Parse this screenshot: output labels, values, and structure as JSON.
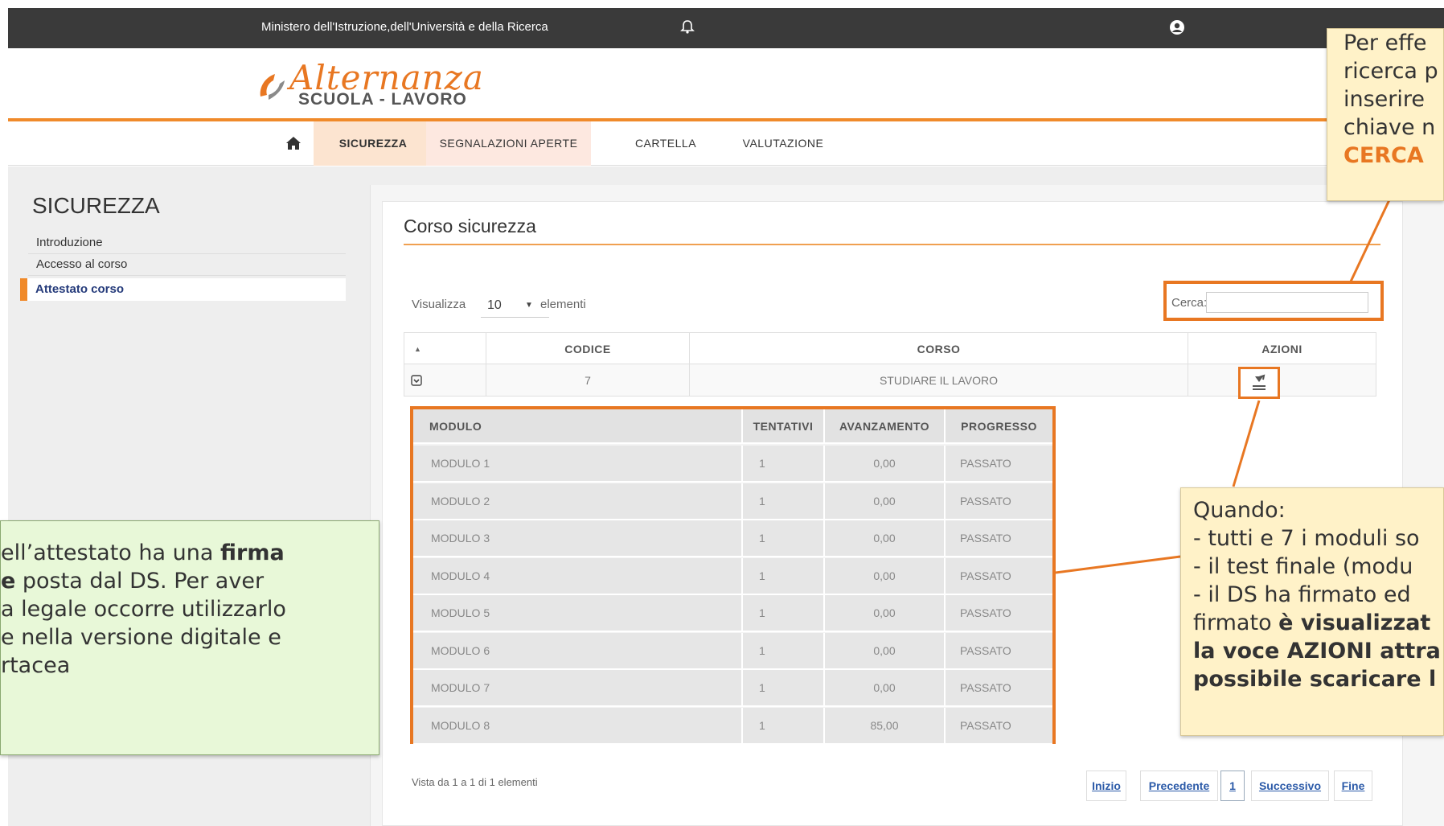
{
  "topbar": {
    "ministry": "Ministero dell'Istruzione,dell'Università e della Ricerca",
    "bell_icon": "bell-icon",
    "user_icon": "user-circle-icon"
  },
  "logo": {
    "line1": "Alternanza",
    "line2": "SCUOLA - LAVORO"
  },
  "nav": {
    "home_icon": "home-icon",
    "items": [
      "SICUREZZA",
      "SEGNALAZIONI APERTE",
      "CARTELLA",
      "VALUTAZIONE"
    ],
    "active": "SICUREZZA"
  },
  "sidebar": {
    "title": "SICUREZZA",
    "items": [
      "Introduzione",
      "Accesso al corso",
      "Attestato corso"
    ],
    "active": "Attestato corso"
  },
  "main": {
    "title": "Corso sicurezza",
    "show_label": "Visualizza",
    "show_value": "10",
    "show_suffix": "elementi",
    "search_label": "Cerca:",
    "search_value": "",
    "table": {
      "headers": [
        "",
        "CODICE",
        "CORSO",
        "AZIONI"
      ],
      "row": {
        "code": "7",
        "course": "STUDIARE IL LAVORO"
      }
    },
    "modules": {
      "headers": [
        "MODULO",
        "TENTATIVI",
        "AVANZAMENTO",
        "PROGRESSO"
      ],
      "rows": [
        [
          "MODULO 1",
          "1",
          "0,00",
          "PASSATO"
        ],
        [
          "MODULO 2",
          "1",
          "0,00",
          "PASSATO"
        ],
        [
          "MODULO 3",
          "1",
          "0,00",
          "PASSATO"
        ],
        [
          "MODULO 4",
          "1",
          "0,00",
          "PASSATO"
        ],
        [
          "MODULO 5",
          "1",
          "0,00",
          "PASSATO"
        ],
        [
          "MODULO 6",
          "1",
          "0,00",
          "PASSATO"
        ],
        [
          "MODULO 7",
          "1",
          "0,00",
          "PASSATO"
        ],
        [
          "MODULO 8",
          "1",
          "85,00",
          "PASSATO"
        ]
      ]
    },
    "footer_info": "Vista da 1 a 1 di 1 elementi",
    "pager": [
      "Inizio",
      "Precedente",
      "1",
      "Successivo",
      "Fine"
    ]
  },
  "callouts": {
    "top": {
      "lines": [
        "Per effe",
        "ricerca p",
        "inserire",
        "chiave n"
      ],
      "cerca": "CERCA"
    },
    "bottom": {
      "l1": "Quando:",
      "l2": "- tutti e 7 i moduli so",
      "l3": "- il test finale (modu",
      "l4": "- il DS ha firmato ed",
      "l5a": "firmato ",
      "l5b": "è visualizzat",
      "l6": "la voce AZIONI attra",
      "l7": "possibile scaricare l"
    },
    "left": {
      "l1a": "ell’attestato ha una ",
      "l1b": "firma",
      "l2a": "e",
      "l2b": " posta dal DS. Per aver",
      "l3": "a legale occorre utilizzarlo",
      "l4": "e nella versione digitale e",
      "l5": "rtacea"
    }
  },
  "colors": {
    "accent": "#e87722",
    "topbar": "#3a3a3a",
    "callout_yellow": "#fff2c8",
    "callout_green": "#e8f8d8",
    "link": "#2b5aa8"
  }
}
